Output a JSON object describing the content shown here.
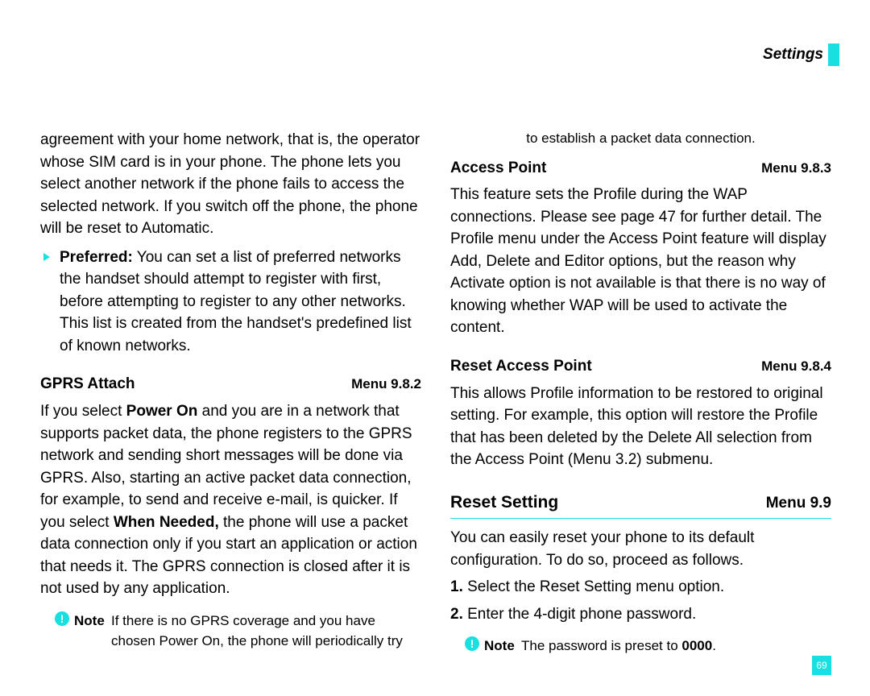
{
  "header": {
    "title": "Settings"
  },
  "left": {
    "intro": "agreement with your home network, that is, the operator whose SIM card is in your phone. The phone lets you select another network if the phone fails to access the selected network. If you switch off the phone, the phone will be reset to Automatic.",
    "preferred_label": "Preferred:",
    "preferred_body": " You can set a list of preferred networks the handset should attempt to register with first, before attempting to register to any other networks. This list is created from the handset's predefined list of known networks.",
    "gprs_title": "GPRS Attach",
    "gprs_menu": "Menu 9.8.2",
    "gprs_body_pre": "If you select ",
    "gprs_power_on": "Power On",
    "gprs_body_mid": " and you are in a network that supports packet data, the phone registers to the GPRS network and sending short messages will be done via GPRS. Also, starting an active packet data connection, for example, to send and receive e-mail, is quicker. If you select ",
    "gprs_when_needed": "When Needed,",
    "gprs_body_post": " the phone will use a packet data connection only if you start an application or action that needs it. The GPRS connection is closed after it is not used by any application.",
    "note_label": "Note",
    "note_body": "If there is no GPRS coverage and you have chosen Power On, the phone will periodically try"
  },
  "right": {
    "cont": "to establish a packet data connection.",
    "ap_title": "Access Point",
    "ap_menu": "Menu 9.8.3",
    "ap_body": "This feature sets the Profile during the WAP connections. Please see page 47 for further detail. The Profile menu under the Access Point feature will display Add, Delete and Editor options, but the reason why Activate option is not available is that there is no way of knowing whether WAP will be used to activate the content.",
    "rap_title": "Reset Access Point",
    "rap_menu": "Menu 9.8.4",
    "rap_body": "This allows Profile information to be restored to original setting. For example, this option will restore the Profile that has been deleted by the Delete All selection from the Access Point (Menu 3.2) submenu.",
    "reset_title": "Reset Setting",
    "reset_menu": "Menu 9.9",
    "reset_body": "You can easily reset your phone to its default configuration. To do so, proceed as follows.",
    "step1_num": "1.",
    "step1_text": " Select the Reset Setting menu option.",
    "step2_num": "2.",
    "step2_text": " Enter the 4-digit phone password.",
    "note_label": "Note",
    "note_body_pre": "The password is preset to ",
    "note_body_code": "0000",
    "note_body_post": "."
  },
  "page_number": "69"
}
